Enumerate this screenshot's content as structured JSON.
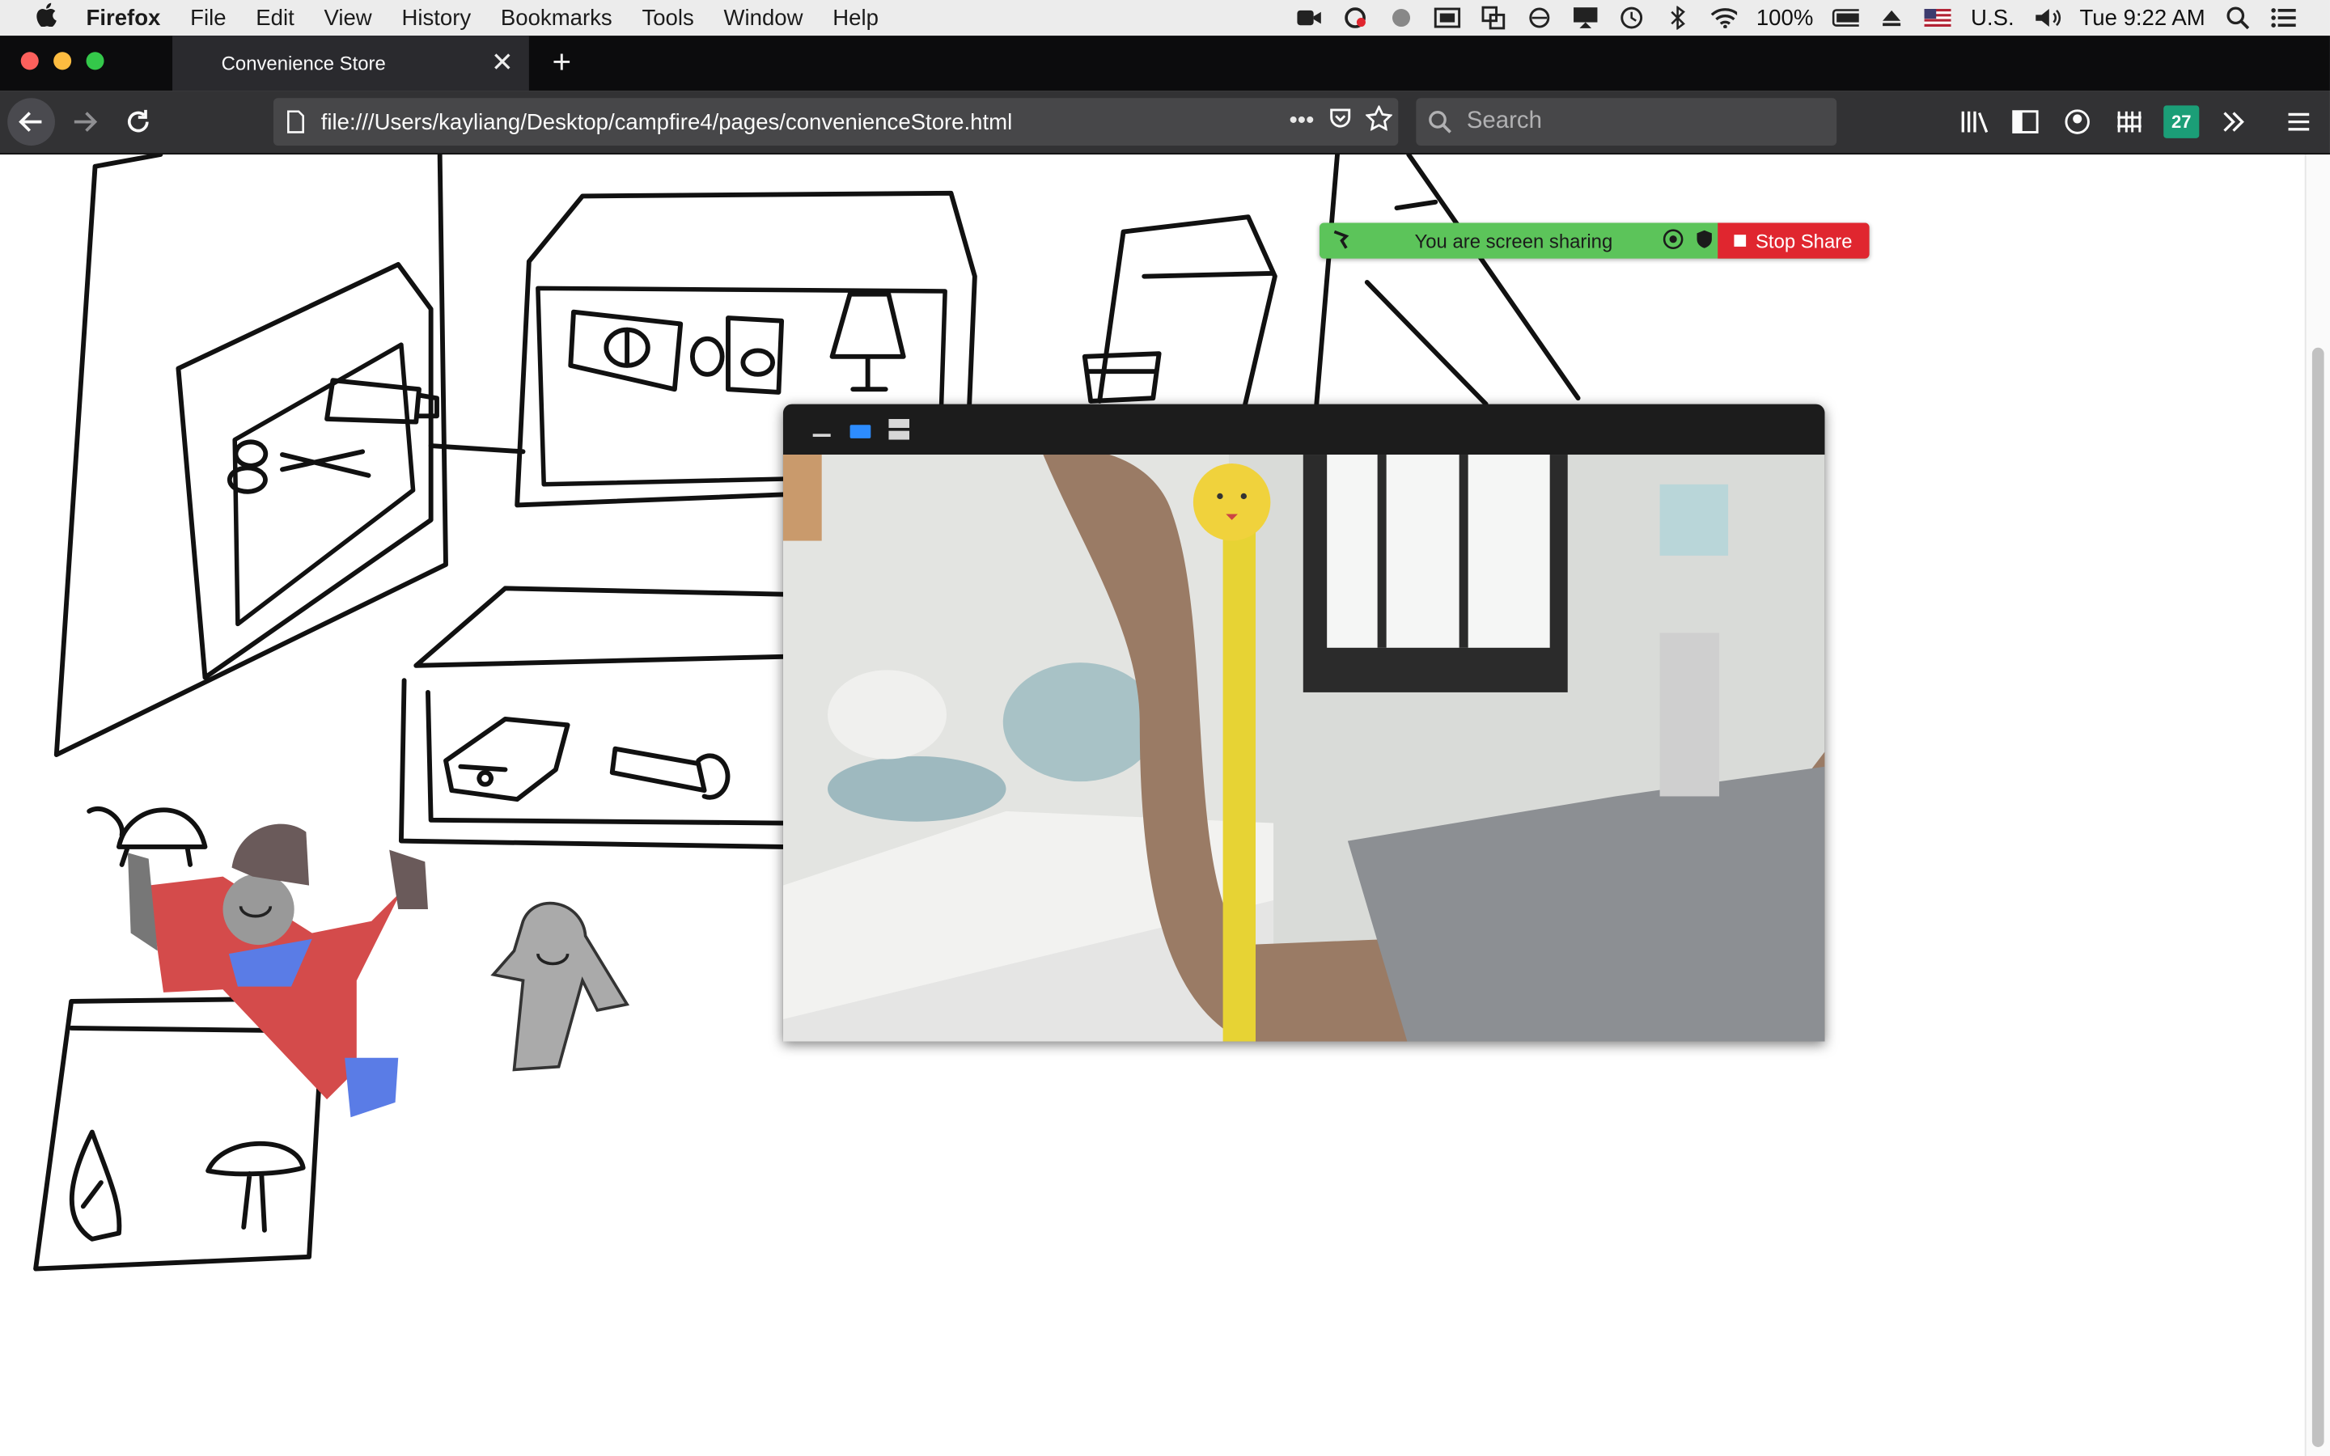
{
  "menubar": {
    "app": "Firefox",
    "items": [
      "File",
      "Edit",
      "View",
      "History",
      "Bookmarks",
      "Tools",
      "Window",
      "Help"
    ],
    "battery": "100%",
    "input_source": "U.S.",
    "clock": "Tue 9:22 AM"
  },
  "tab": {
    "title": "Convenience Store"
  },
  "navbar": {
    "url": "file:///Users/kayliang/Desktop/campfire4/pages/convenienceStore.html",
    "search_placeholder": "Search",
    "badge": "27"
  },
  "share": {
    "status": "You are screen sharing",
    "stop_label": "Stop Share",
    "colors": {
      "bar": "#5cc45a",
      "stop": "#e0262f"
    }
  }
}
